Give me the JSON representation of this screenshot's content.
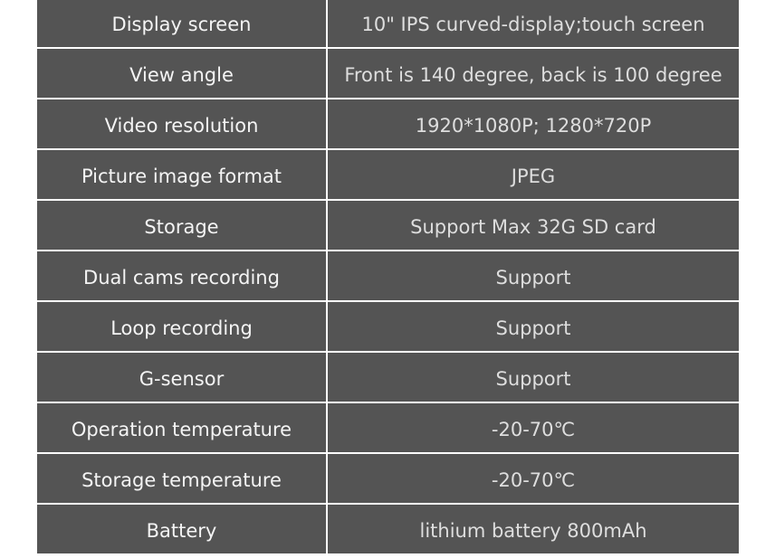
{
  "specs": [
    {
      "label": "Display screen",
      "value": "10\" IPS curved-display;touch screen"
    },
    {
      "label": "View angle",
      "value": "Front is 140 degree, back is 100 degree"
    },
    {
      "label": "Video resolution",
      "value": "1920*1080P; 1280*720P"
    },
    {
      "label": "Picture image format",
      "value": "JPEG"
    },
    {
      "label": "Storage",
      "value": "Support Max 32G SD card"
    },
    {
      "label": "Dual cams recording",
      "value": "Support"
    },
    {
      "label": "Loop recording",
      "value": "Support"
    },
    {
      "label": "G-sensor",
      "value": "Support"
    },
    {
      "label": "Operation temperature",
      "value": "-20-70℃"
    },
    {
      "label": "Storage temperature",
      "value": "-20-70℃"
    },
    {
      "label": "Battery",
      "value": "lithium battery 800mAh"
    }
  ]
}
